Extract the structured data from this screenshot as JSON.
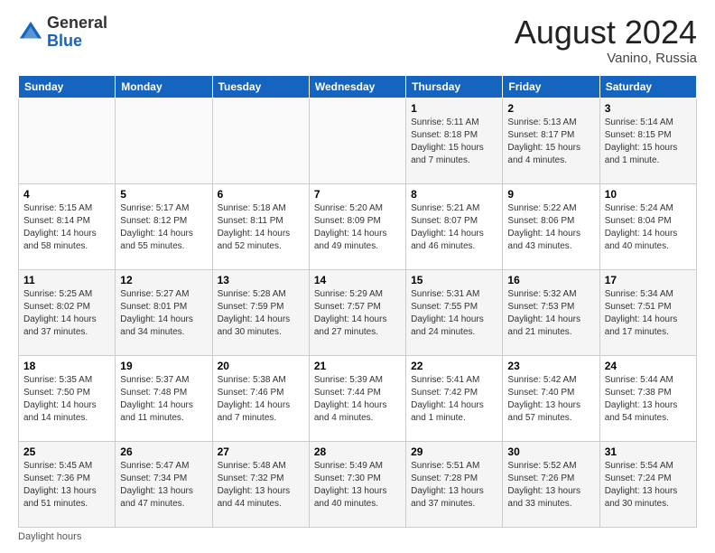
{
  "header": {
    "logo": {
      "general": "General",
      "blue": "Blue"
    },
    "title": "August 2024",
    "location": "Vanino, Russia"
  },
  "days_of_week": [
    "Sunday",
    "Monday",
    "Tuesday",
    "Wednesday",
    "Thursday",
    "Friday",
    "Saturday"
  ],
  "weeks": [
    [
      {
        "day": "",
        "info": ""
      },
      {
        "day": "",
        "info": ""
      },
      {
        "day": "",
        "info": ""
      },
      {
        "day": "",
        "info": ""
      },
      {
        "day": "1",
        "info": "Sunrise: 5:11 AM\nSunset: 8:18 PM\nDaylight: 15 hours and 7 minutes."
      },
      {
        "day": "2",
        "info": "Sunrise: 5:13 AM\nSunset: 8:17 PM\nDaylight: 15 hours and 4 minutes."
      },
      {
        "day": "3",
        "info": "Sunrise: 5:14 AM\nSunset: 8:15 PM\nDaylight: 15 hours and 1 minute."
      }
    ],
    [
      {
        "day": "4",
        "info": "Sunrise: 5:15 AM\nSunset: 8:14 PM\nDaylight: 14 hours and 58 minutes."
      },
      {
        "day": "5",
        "info": "Sunrise: 5:17 AM\nSunset: 8:12 PM\nDaylight: 14 hours and 55 minutes."
      },
      {
        "day": "6",
        "info": "Sunrise: 5:18 AM\nSunset: 8:11 PM\nDaylight: 14 hours and 52 minutes."
      },
      {
        "day": "7",
        "info": "Sunrise: 5:20 AM\nSunset: 8:09 PM\nDaylight: 14 hours and 49 minutes."
      },
      {
        "day": "8",
        "info": "Sunrise: 5:21 AM\nSunset: 8:07 PM\nDaylight: 14 hours and 46 minutes."
      },
      {
        "day": "9",
        "info": "Sunrise: 5:22 AM\nSunset: 8:06 PM\nDaylight: 14 hours and 43 minutes."
      },
      {
        "day": "10",
        "info": "Sunrise: 5:24 AM\nSunset: 8:04 PM\nDaylight: 14 hours and 40 minutes."
      }
    ],
    [
      {
        "day": "11",
        "info": "Sunrise: 5:25 AM\nSunset: 8:02 PM\nDaylight: 14 hours and 37 minutes."
      },
      {
        "day": "12",
        "info": "Sunrise: 5:27 AM\nSunset: 8:01 PM\nDaylight: 14 hours and 34 minutes."
      },
      {
        "day": "13",
        "info": "Sunrise: 5:28 AM\nSunset: 7:59 PM\nDaylight: 14 hours and 30 minutes."
      },
      {
        "day": "14",
        "info": "Sunrise: 5:29 AM\nSunset: 7:57 PM\nDaylight: 14 hours and 27 minutes."
      },
      {
        "day": "15",
        "info": "Sunrise: 5:31 AM\nSunset: 7:55 PM\nDaylight: 14 hours and 24 minutes."
      },
      {
        "day": "16",
        "info": "Sunrise: 5:32 AM\nSunset: 7:53 PM\nDaylight: 14 hours and 21 minutes."
      },
      {
        "day": "17",
        "info": "Sunrise: 5:34 AM\nSunset: 7:51 PM\nDaylight: 14 hours and 17 minutes."
      }
    ],
    [
      {
        "day": "18",
        "info": "Sunrise: 5:35 AM\nSunset: 7:50 PM\nDaylight: 14 hours and 14 minutes."
      },
      {
        "day": "19",
        "info": "Sunrise: 5:37 AM\nSunset: 7:48 PM\nDaylight: 14 hours and 11 minutes."
      },
      {
        "day": "20",
        "info": "Sunrise: 5:38 AM\nSunset: 7:46 PM\nDaylight: 14 hours and 7 minutes."
      },
      {
        "day": "21",
        "info": "Sunrise: 5:39 AM\nSunset: 7:44 PM\nDaylight: 14 hours and 4 minutes."
      },
      {
        "day": "22",
        "info": "Sunrise: 5:41 AM\nSunset: 7:42 PM\nDaylight: 14 hours and 1 minute."
      },
      {
        "day": "23",
        "info": "Sunrise: 5:42 AM\nSunset: 7:40 PM\nDaylight: 13 hours and 57 minutes."
      },
      {
        "day": "24",
        "info": "Sunrise: 5:44 AM\nSunset: 7:38 PM\nDaylight: 13 hours and 54 minutes."
      }
    ],
    [
      {
        "day": "25",
        "info": "Sunrise: 5:45 AM\nSunset: 7:36 PM\nDaylight: 13 hours and 51 minutes."
      },
      {
        "day": "26",
        "info": "Sunrise: 5:47 AM\nSunset: 7:34 PM\nDaylight: 13 hours and 47 minutes."
      },
      {
        "day": "27",
        "info": "Sunrise: 5:48 AM\nSunset: 7:32 PM\nDaylight: 13 hours and 44 minutes."
      },
      {
        "day": "28",
        "info": "Sunrise: 5:49 AM\nSunset: 7:30 PM\nDaylight: 13 hours and 40 minutes."
      },
      {
        "day": "29",
        "info": "Sunrise: 5:51 AM\nSunset: 7:28 PM\nDaylight: 13 hours and 37 minutes."
      },
      {
        "day": "30",
        "info": "Sunrise: 5:52 AM\nSunset: 7:26 PM\nDaylight: 13 hours and 33 minutes."
      },
      {
        "day": "31",
        "info": "Sunrise: 5:54 AM\nSunset: 7:24 PM\nDaylight: 13 hours and 30 minutes."
      }
    ]
  ],
  "footer": {
    "note": "Daylight hours"
  }
}
